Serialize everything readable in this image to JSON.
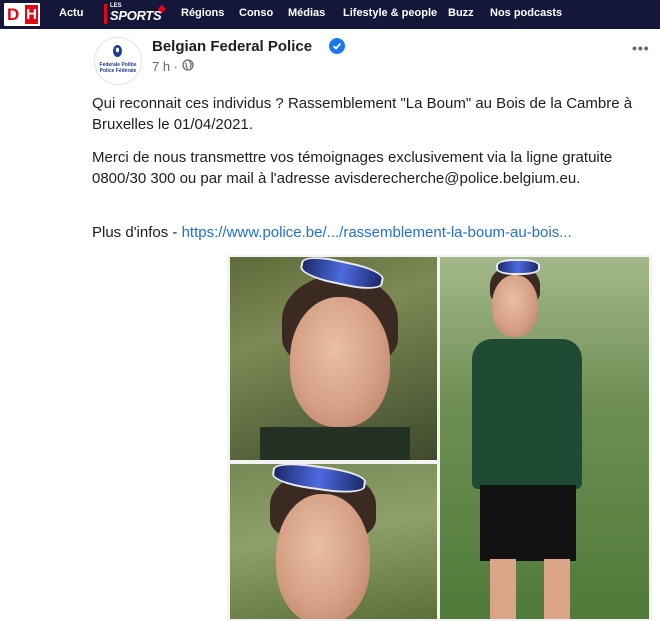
{
  "topnav": {
    "logo_d": "D",
    "logo_h": "H",
    "items": [
      "Actu",
      "Régions",
      "Conso",
      "Médias",
      "Lifestyle & people",
      "Buzz",
      "Nos podcasts"
    ],
    "sports_small": "LES",
    "sports_big": "SPORTS"
  },
  "post": {
    "page_name": "Belgian Federal Police",
    "time": "7 h ·",
    "avatar_line1": "Federale Politie",
    "avatar_line2": "Police Fédérale",
    "paragraph1": "Qui reconnait ces individus ? Rassemblement \"La Boum\" au Bois de la Cambre à Bruxelles le 01/04/2021.",
    "paragraph2": "Merci de nous transmettre vos témoignages exclusivement via la ligne gratuite 0800/30 300 ou par mail à l'adresse avisderecherche@police.belgium.eu.",
    "more_info_label": "Plus d'infos - ",
    "more_info_link": "https://www.police.be/.../rassemblement-la-boum-au-bois..."
  },
  "icons": {
    "verified": "check-badge",
    "globe": "globe",
    "more": "ellipsis"
  },
  "colors": {
    "nav_bg": "#14163a",
    "brand_red": "#e30613",
    "link": "#216fdb",
    "verified": "#1877f2"
  }
}
